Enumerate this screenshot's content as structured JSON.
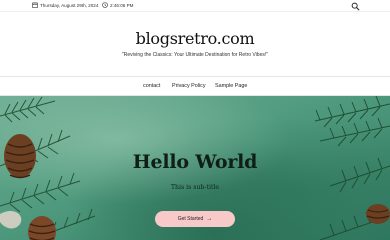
{
  "topbar": {
    "date": "Thursday, August 29th, 2024",
    "time": "2:46:06 PM",
    "icons": [
      "calendar-icon",
      "clock-icon",
      "search-icon"
    ]
  },
  "header": {
    "site_title": "blogsretro.com",
    "tagline": "\"Reviving the Classics: Your Ultimate Destination for Retro Vibes!\""
  },
  "nav": {
    "items": [
      {
        "label": "contact"
      },
      {
        "label": "Privacy Policy"
      },
      {
        "label": "Sample Page"
      }
    ]
  },
  "hero": {
    "title": "Hello World",
    "subtitle": "This is sub-title",
    "cta_label": "Get Started",
    "cta_icon": "arrow-right-icon",
    "colors": {
      "background": "#4f9a7e",
      "button": "#f7c9c9"
    }
  }
}
